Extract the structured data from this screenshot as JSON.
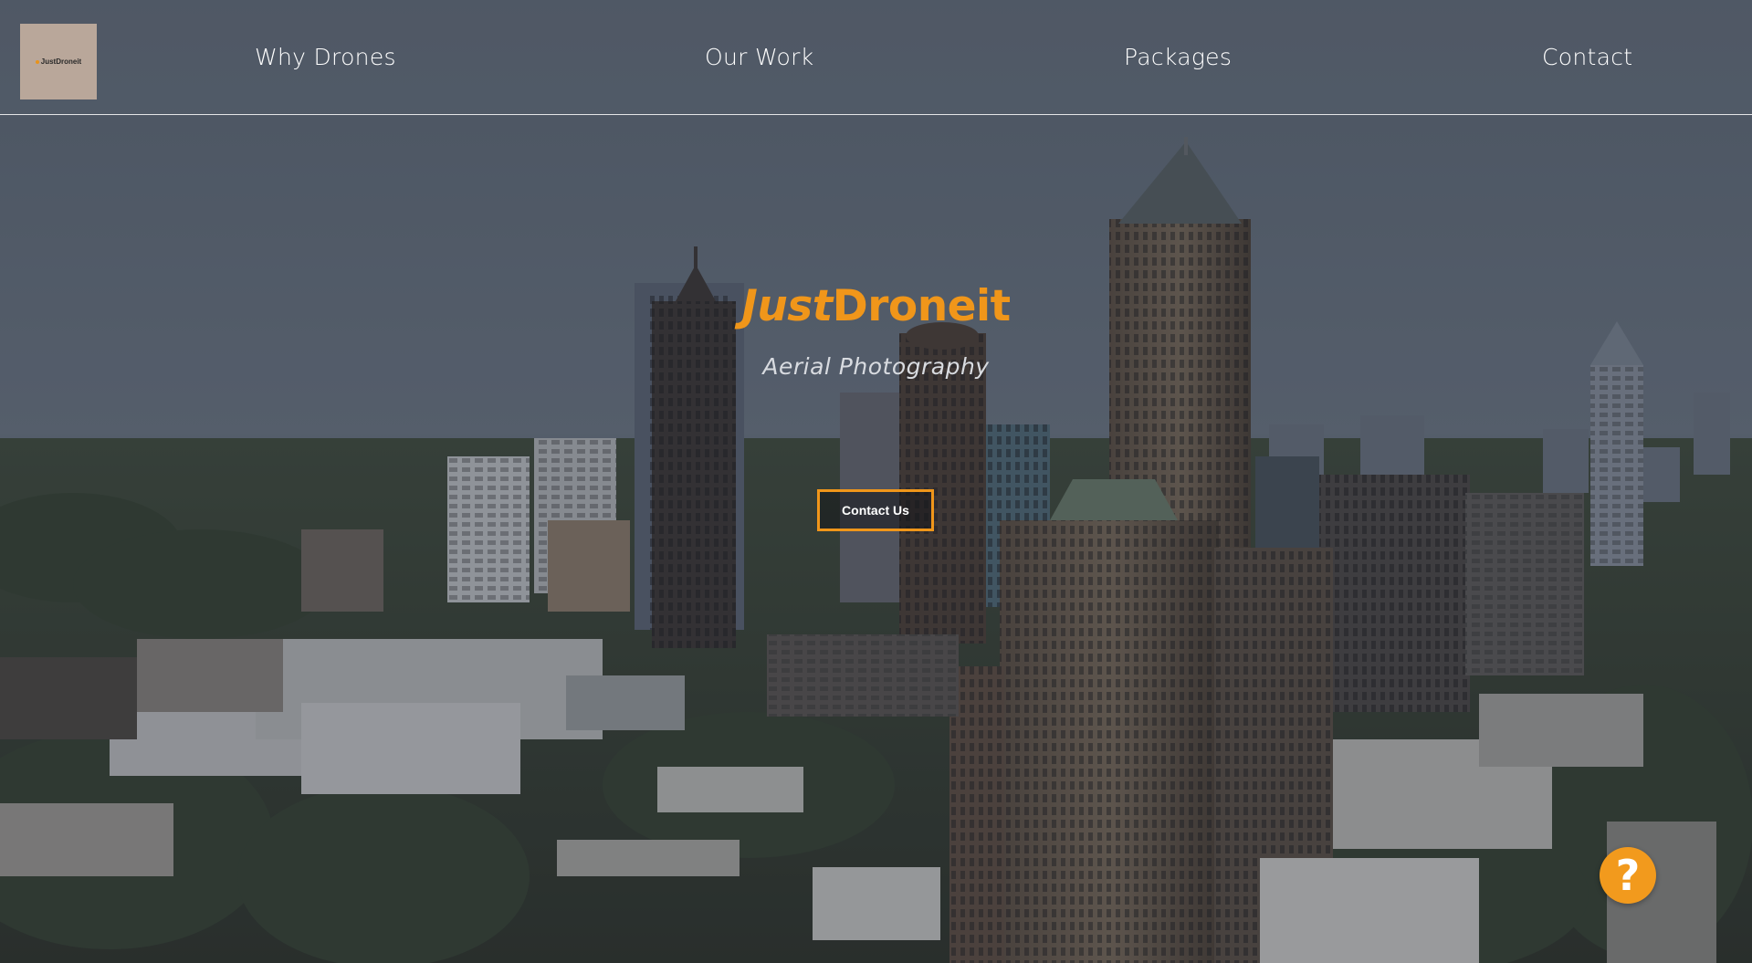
{
  "header": {
    "logo": {
      "text": "JustDroneit",
      "icon": "logo-icon"
    },
    "nav": [
      {
        "label": "Why Drones"
      },
      {
        "label": "Our Work"
      },
      {
        "label": "Packages"
      },
      {
        "label": "Contact"
      }
    ]
  },
  "hero": {
    "title_italic": "Just",
    "title_rest": "Droneit",
    "subtitle": "Aerial Photography",
    "cta_label": "Contact Us"
  },
  "help_button": {
    "glyph": "?",
    "icon": "help-icon"
  },
  "colors": {
    "accent": "#f0961a",
    "text": "#ffffff",
    "logo_bg": "#b9a79a"
  }
}
